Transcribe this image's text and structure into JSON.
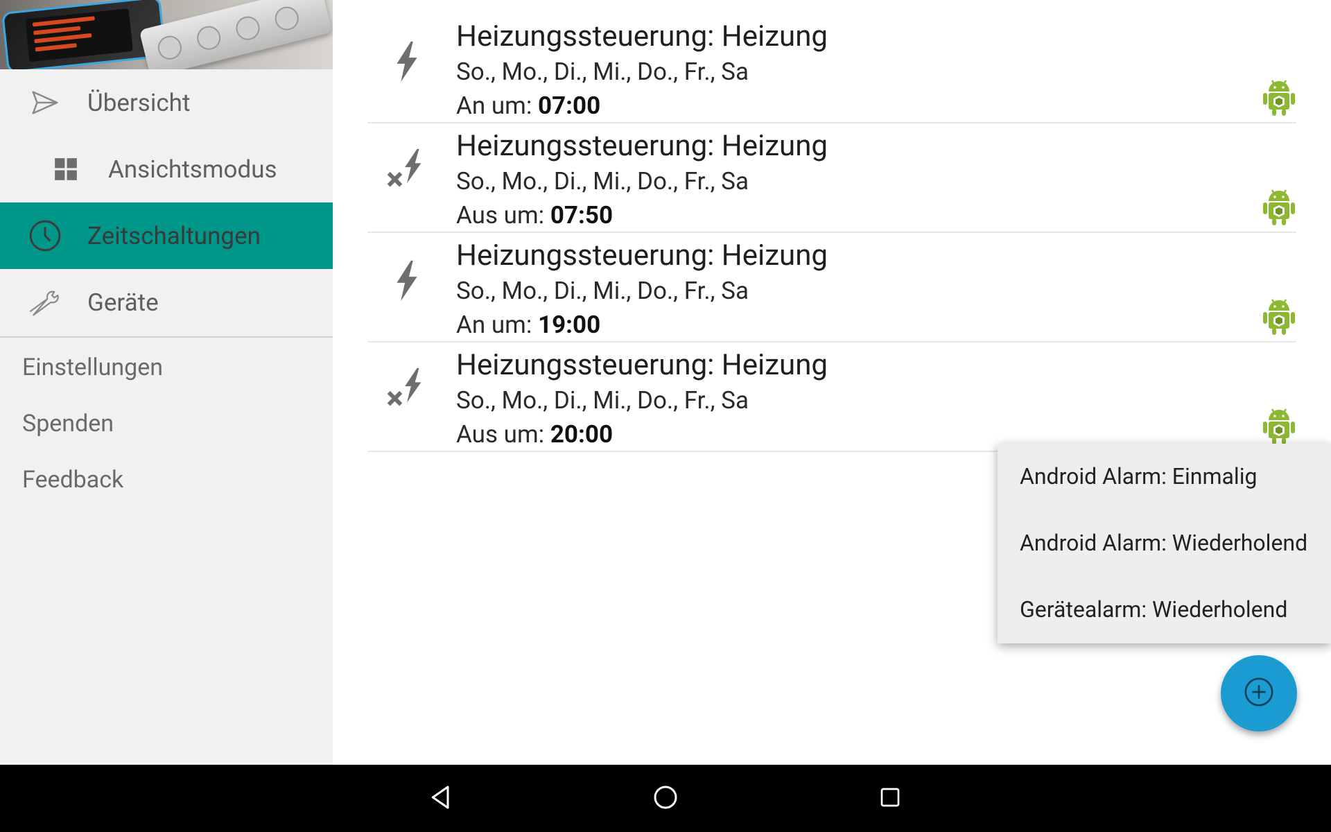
{
  "sidebar": {
    "items": [
      {
        "label": "Übersicht",
        "icon": "send-icon"
      },
      {
        "label": "Ansichtsmodus",
        "icon": "grid-icon"
      },
      {
        "label": "Zeitschaltungen",
        "icon": "clock-icon",
        "active": true
      },
      {
        "label": "Geräte",
        "icon": "wrench-icon"
      }
    ],
    "extra": {
      "settings": "Einstellungen",
      "donate": "Spenden",
      "feedback": "Feedback"
    }
  },
  "timers": [
    {
      "title": "Heizungssteuerung: Heizung",
      "days": "So., Mo., Di., Mi., Do., Fr., Sa",
      "action_label": "An um:",
      "time": "07:00",
      "icon": "power-on-icon"
    },
    {
      "title": "Heizungssteuerung: Heizung",
      "days": "So., Mo., Di., Mi., Do., Fr., Sa",
      "action_label": "Aus um:",
      "time": "07:50",
      "icon": "power-off-icon"
    },
    {
      "title": "Heizungssteuerung: Heizung",
      "days": "So., Mo., Di., Mi., Do., Fr., Sa",
      "action_label": "An um:",
      "time": "19:00",
      "icon": "power-on-icon"
    },
    {
      "title": "Heizungssteuerung: Heizung",
      "days": "So., Mo., Di., Mi., Do., Fr., Sa",
      "action_label": "Aus um:",
      "time": "20:00",
      "icon": "power-off-icon"
    }
  ],
  "popup_menu": {
    "items": [
      "Android Alarm: Einmalig",
      "Android Alarm: Wiederholend",
      "Gerätealarm: Wiederholend"
    ]
  },
  "colors": {
    "accent": "#00978a",
    "fab": "#1a9cd3",
    "android_green": "#8cb832"
  }
}
